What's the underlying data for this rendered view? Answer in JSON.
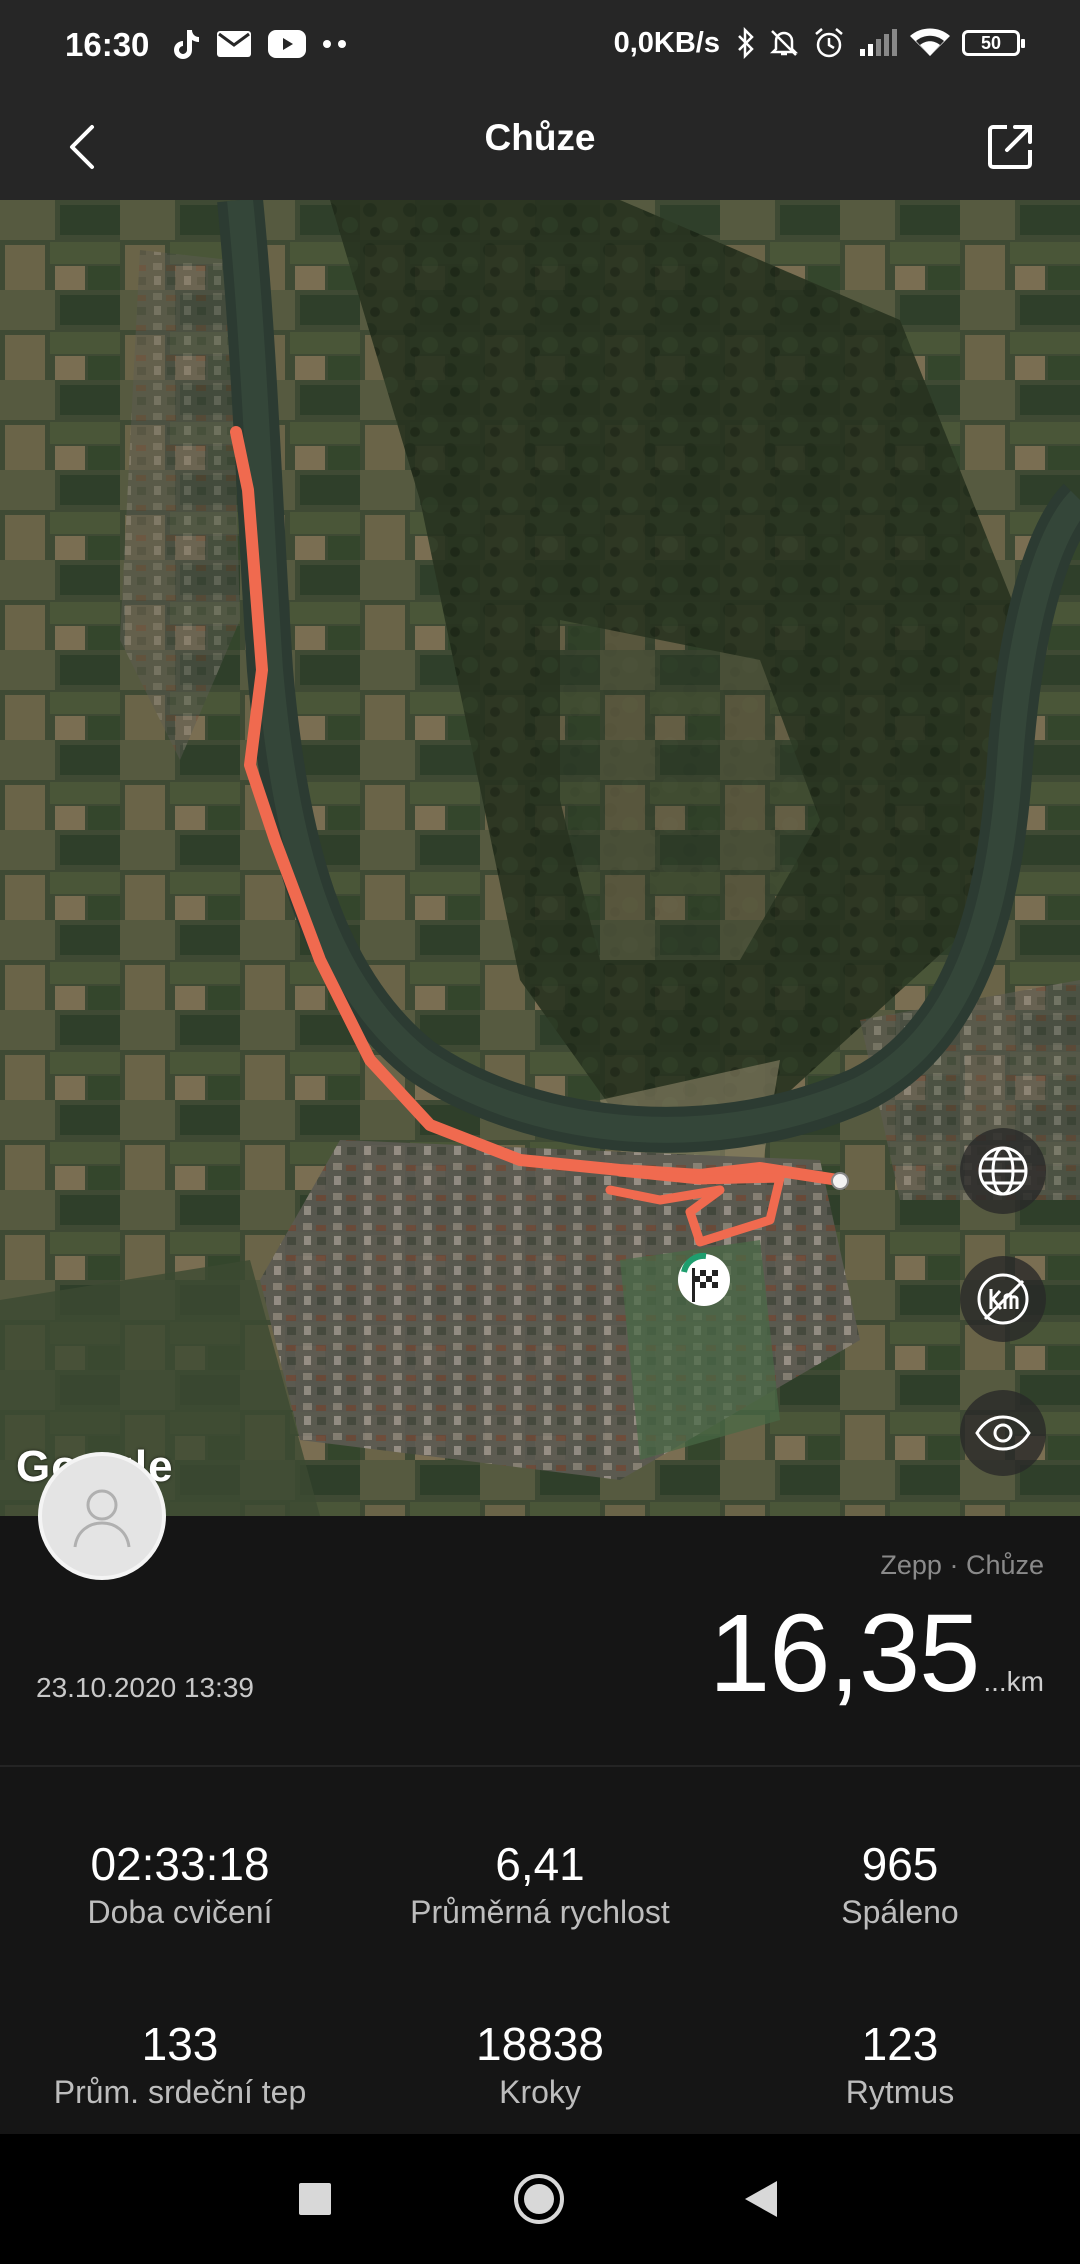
{
  "status_bar": {
    "time": "16:30",
    "left_icons": [
      "tiktok-icon",
      "mail-icon",
      "youtube-icon",
      "more-dots-icon"
    ],
    "net_speed": "0,0KB/s",
    "right_icons": [
      "bluetooth-icon",
      "mute-icon",
      "alarm-icon",
      "signal-icon",
      "wifi-icon"
    ],
    "battery": "50"
  },
  "header": {
    "title": "Chůze",
    "back_icon": "chevron-left-icon",
    "share_icon": "share-icon"
  },
  "map": {
    "attribution": "Google",
    "route_color": "#f06a4f",
    "controls": [
      "globe-icon",
      "km-off-icon",
      "eye-icon"
    ]
  },
  "summary": {
    "source": "Zepp · Chůze",
    "distance": "16,35",
    "distance_unit": "...km",
    "datetime": "23.10.2020 13:39"
  },
  "stats": [
    {
      "value": "02:33:18",
      "label": "Doba cvičení"
    },
    {
      "value": "6,41",
      "label": "Průměrná rychlost"
    },
    {
      "value": "965",
      "label": "Spáleno"
    },
    {
      "value": "133",
      "label": "Prům. srdeční tep"
    },
    {
      "value": "18838",
      "label": "Kroky"
    },
    {
      "value": "123",
      "label": "Rytmus"
    }
  ],
  "nav": [
    "recents-button",
    "home-button",
    "back-button"
  ]
}
